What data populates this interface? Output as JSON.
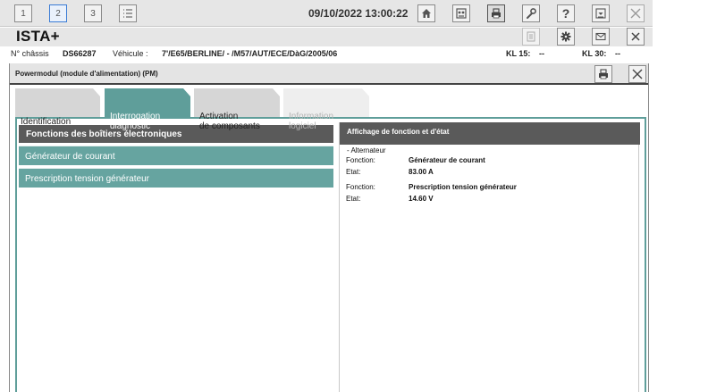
{
  "toolbar": {
    "tab_buttons": [
      "1",
      "2",
      "3"
    ],
    "datetime": "09/10/2022 13:00:22"
  },
  "app": {
    "title": "ISTA+"
  },
  "vehicle": {
    "chassis_label": "N° châssis",
    "chassis_value": "DS66287",
    "vehicle_label": "Véhicule :",
    "vehicle_value": "7'/E65/BERLINE/ - /M57/AUT/ECE/DàG/2005/06",
    "kl15_label": "KL 15:",
    "kl15_value": "--",
    "kl30_label": "KL 30:",
    "kl30_value": "--"
  },
  "module": {
    "title": "Powermodul (module d'alimentation) (PM)",
    "tabs": [
      {
        "label": "Identification",
        "state": "inactive"
      },
      {
        "label": "Interrogation\ndiagnostic",
        "state": "active"
      },
      {
        "label": "Activation\nde composants",
        "state": "inactive"
      },
      {
        "label": "Information\nlogiciel",
        "state": "disabled"
      }
    ],
    "left_header": "Fonctions des boîtiers électroniques",
    "left_items": [
      "Générateur de courant",
      "Prescription tension générateur"
    ],
    "right_header": "Affichage de fonction et d'état",
    "group_title": "- Alternateur",
    "rows": [
      {
        "label": "Fonction:",
        "value": "Générateur de courant"
      },
      {
        "label": "Etat:",
        "value": "83.00  A"
      },
      {
        "label": "Fonction:",
        "value": "Prescription tension générateur"
      },
      {
        "label": "Etat:",
        "value": "14.60  V"
      }
    ]
  },
  "colors": {
    "teal": "#66a4a0",
    "header_dark": "#5a5a5a",
    "chrome": "#e6e6e6"
  }
}
